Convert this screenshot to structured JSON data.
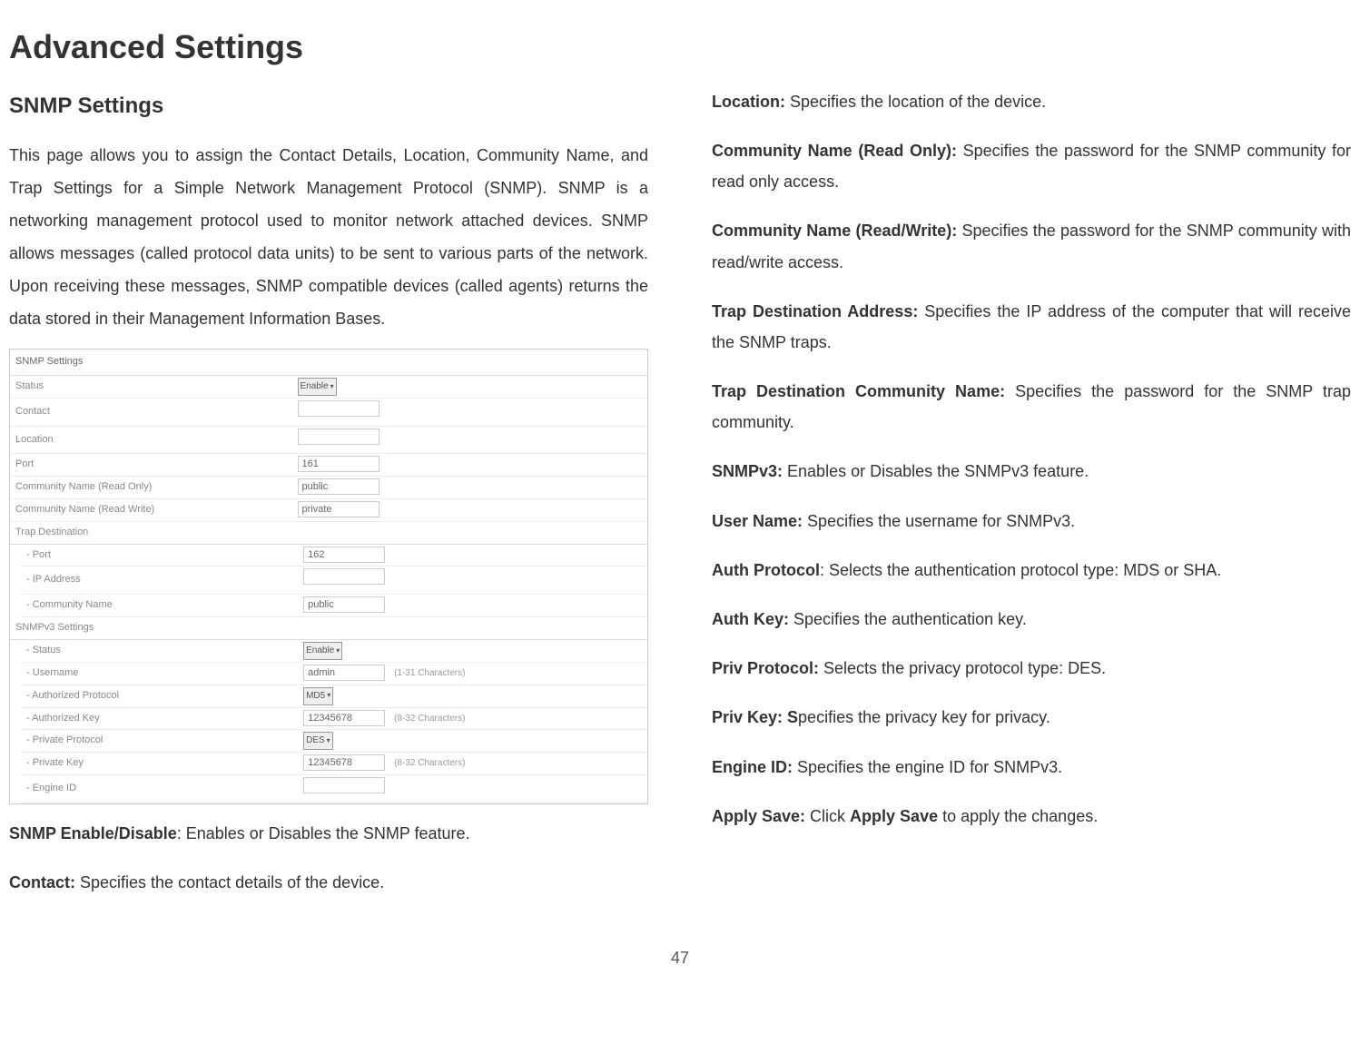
{
  "page_title": "Advanced Settings",
  "page_number": "47",
  "left": {
    "section_title": "SNMP Settings",
    "intro": "This page allows you to assign the Contact Details, Location, Community Name, and Trap Settings for a Simple Network Management Protocol (SNMP). SNMP is a networking management protocol used to monitor network attached devices. SNMP allows messages (called protocol data units) to be sent to various parts of the network. Upon receiving these messages, SNMP compatible devices (called agents) returns the data stored in their Management Information Bases.",
    "screenshot": {
      "header": "SNMP Settings",
      "rows": [
        {
          "label": "Status",
          "type": "select",
          "value": "Enable"
        },
        {
          "label": "Contact",
          "type": "input",
          "value": ""
        },
        {
          "label": "Location",
          "type": "input",
          "value": ""
        },
        {
          "label": "Port",
          "type": "input",
          "value": "161"
        },
        {
          "label": "Community Name (Read Only)",
          "type": "input",
          "value": "public"
        },
        {
          "label": "Community Name (Read Write)",
          "type": "input",
          "value": "private"
        }
      ],
      "trap_header": "Trap Destination",
      "trap_rows": [
        {
          "label": "- Port",
          "type": "input",
          "value": "162"
        },
        {
          "label": "- IP Address",
          "type": "input",
          "value": ""
        },
        {
          "label": "- Community Name",
          "type": "input",
          "value": "public"
        }
      ],
      "v3_header": "SNMPv3 Settings",
      "v3_rows": [
        {
          "label": "- Status",
          "type": "select",
          "value": "Enable",
          "note": ""
        },
        {
          "label": "- Username",
          "type": "input",
          "value": "admin",
          "note": "(1-31 Characters)"
        },
        {
          "label": "- Authorized Protocol",
          "type": "select",
          "value": "MD5",
          "note": ""
        },
        {
          "label": "- Authorized Key",
          "type": "input",
          "value": "12345678",
          "note": "(8-32 Characters)"
        },
        {
          "label": "- Private Protocol",
          "type": "select",
          "value": "DES",
          "note": ""
        },
        {
          "label": "- Private Key",
          "type": "input",
          "value": "12345678",
          "note": "(8-32 Characters)"
        },
        {
          "label": "- Engine ID",
          "type": "input",
          "value": "",
          "note": ""
        }
      ]
    },
    "def1_bold": "SNMP Enable/Disable",
    "def1_text": ": Enables or Disables the SNMP feature.",
    "def2_bold": "Contact:",
    "def2_text": " Specifies the contact details of the device."
  },
  "right": {
    "defs": [
      {
        "bold": "Location:",
        "text": " Specifies the location of the device."
      },
      {
        "bold": "Community Name (Read Only):",
        "text": " Specifies the password for the SNMP community for read only access."
      },
      {
        "bold": "Community Name (Read/Write):",
        "text": " Specifies the password for the SNMP community with read/write access."
      },
      {
        "bold": "Trap Destination Address:",
        "text": " Specifies the IP address of the computer that will receive the SNMP traps."
      },
      {
        "bold": "Trap Destination Community Name:",
        "text": " Specifies the password for the SNMP trap community."
      },
      {
        "bold": "SNMPv3:",
        "text": " Enables or Disables the SNMPv3 feature."
      },
      {
        "bold": "User Name:",
        "text": " Specifies the username for SNMPv3."
      },
      {
        "bold": "Auth Protocol",
        "text": ": Selects the authentication protocol type: MDS or SHA."
      },
      {
        "bold": "Auth Key:",
        "text": " Specifies the authentication key."
      },
      {
        "bold": "Priv Protocol:",
        "text": " Selects the privacy protocol type: DES."
      },
      {
        "bold": "Priv Key: S",
        "text": "pecifies the privacy key for privacy."
      },
      {
        "bold": "Engine ID:",
        "text": " Specifies the engine ID for SNMPv3."
      }
    ],
    "apply_bold1": "Apply Save:",
    "apply_text": " Click ",
    "apply_bold2": "Apply Save",
    "apply_text2": " to apply the changes."
  }
}
